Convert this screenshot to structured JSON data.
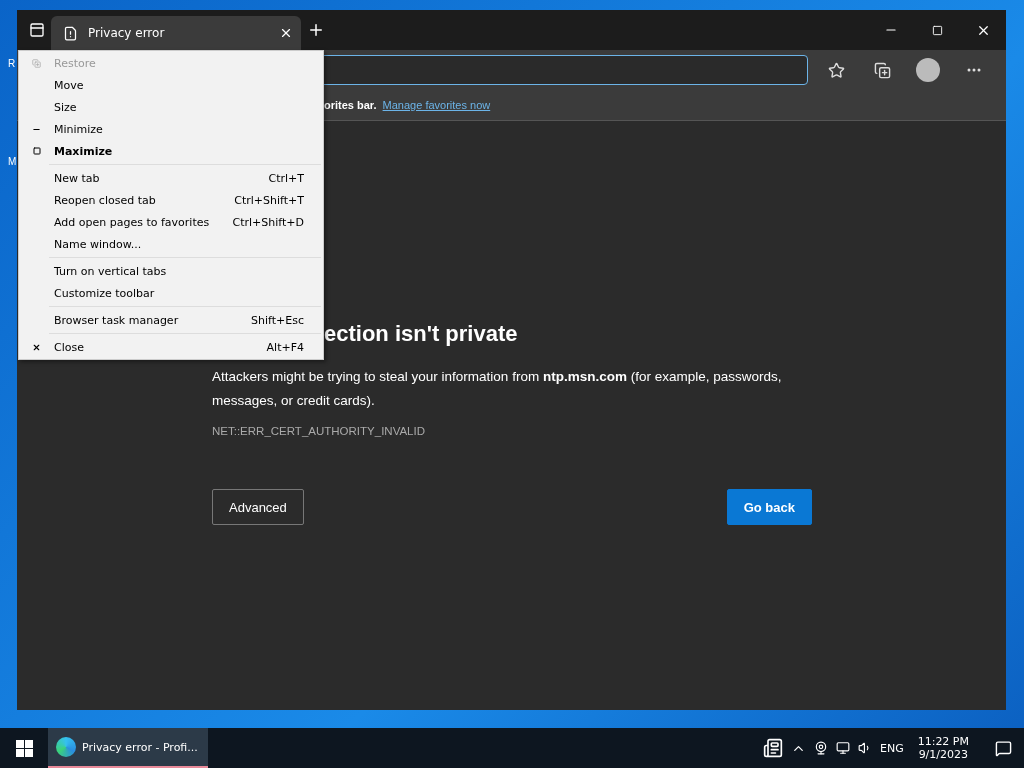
{
  "desktop": {
    "icon_labels": [
      "R",
      "M"
    ]
  },
  "browser": {
    "tab": {
      "title": "Privacy error",
      "selected": true
    },
    "favorites_bar": {
      "text": "orites bar.",
      "link": "Manage favorites now"
    },
    "page": {
      "heading": "ection isn't private",
      "message": "Attackers might be trying to steal your information from **ntp.msn.com** (for example, passwords, messages, or credit cards).",
      "error_code": "NET::ERR_CERT_AUTHORITY_INVALID",
      "buttons": [
        {
          "label": "Advanced",
          "kind": "secondary"
        },
        {
          "label": "Go back",
          "kind": "primary"
        }
      ]
    }
  },
  "system_menu": {
    "groups": [
      [
        {
          "label": "Restore",
          "kind": "restore",
          "disabled": true,
          "bold": false
        },
        {
          "label": "Move",
          "kind": "plain",
          "disabled": false,
          "bold": false
        },
        {
          "label": "Size",
          "kind": "plain",
          "disabled": false,
          "bold": false
        },
        {
          "label": "Minimize",
          "kind": "minimize",
          "disabled": false,
          "bold": false
        },
        {
          "label": "Maximize",
          "kind": "maximize",
          "disabled": false,
          "bold": true
        }
      ],
      [
        {
          "label": "New tab",
          "kind": "plain",
          "shortcut": "Ctrl+T",
          "disabled": false,
          "bold": false
        },
        {
          "label": "Reopen closed tab",
          "kind": "plain",
          "shortcut": "Ctrl+Shift+T",
          "disabled": false,
          "bold": false
        },
        {
          "label": "Add open pages to favorites",
          "kind": "plain",
          "shortcut": "Ctrl+Shift+D",
          "disabled": false,
          "bold": false
        },
        {
          "label": "Name window...",
          "kind": "plain",
          "disabled": false,
          "bold": false
        }
      ],
      [
        {
          "label": "Turn on vertical tabs",
          "kind": "plain",
          "disabled": false,
          "bold": false
        },
        {
          "label": "Customize toolbar",
          "kind": "plain",
          "disabled": false,
          "bold": false
        }
      ],
      [
        {
          "label": "Browser task manager",
          "kind": "plain",
          "shortcut": "Shift+Esc",
          "disabled": false,
          "bold": false
        }
      ],
      [
        {
          "label": "Close",
          "kind": "close",
          "shortcut": "Alt+F4",
          "disabled": false,
          "bold": false
        }
      ]
    ]
  },
  "taskbar": {
    "app": {
      "label": "Privacy error - Profi...",
      "selected": true
    },
    "language": "ENG",
    "time": "11:22 PM",
    "date": "9/1/2023"
  }
}
